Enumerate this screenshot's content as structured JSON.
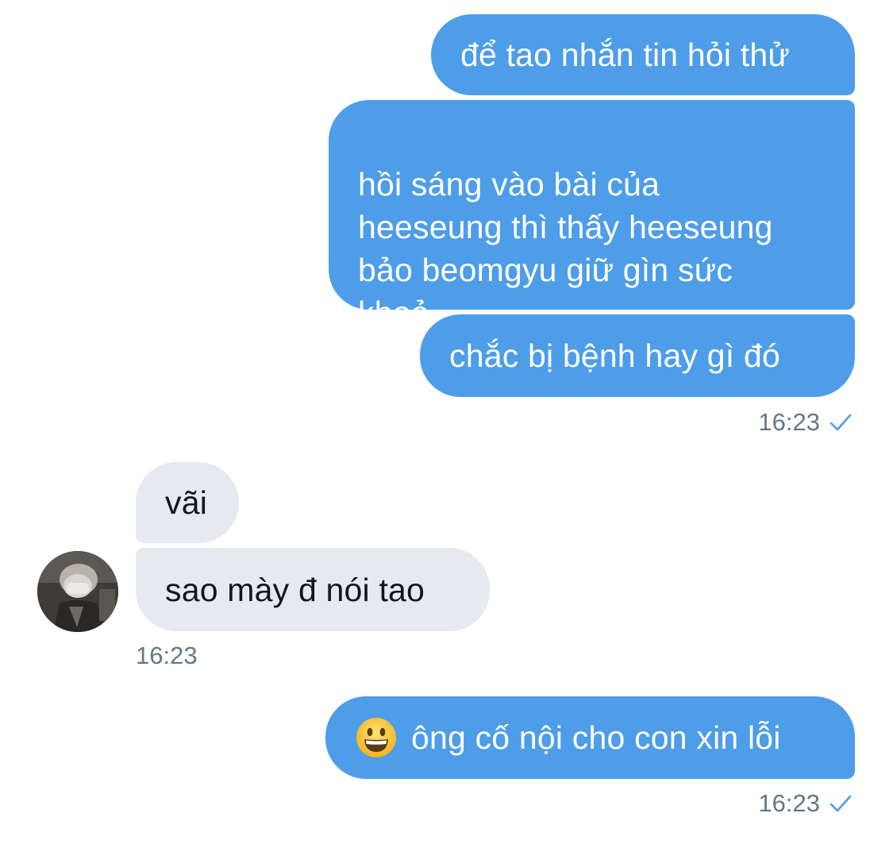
{
  "messages": {
    "m1": {
      "text": "để tao nhắn tin hỏi thử"
    },
    "m2": {
      "text": "hồi sáng vào bài của\nheeseung thì thấy heeseung\nbảo beomgyu giữ gìn sức\nkhoẻ"
    },
    "m3": {
      "text": "chắc bị bệnh hay gì đó"
    },
    "group1_time": "16:23",
    "m4": {
      "text": "vãi"
    },
    "m5": {
      "text": "sao mày đ nói tao"
    },
    "group2_time": "16:23",
    "m6": {
      "emoji": "grinning-face",
      "text": "ông cố nội cho con xin lỗi"
    },
    "group3_time": "16:23"
  },
  "icons": {
    "read_receipt": "checkmark-icon",
    "avatar": "user-avatar-photo"
  },
  "colors": {
    "outgoing_bubble": "#4d9de8",
    "incoming_bubble": "#e6e9ef",
    "timestamp": "#657786",
    "checkmark": "#4d9de8"
  }
}
